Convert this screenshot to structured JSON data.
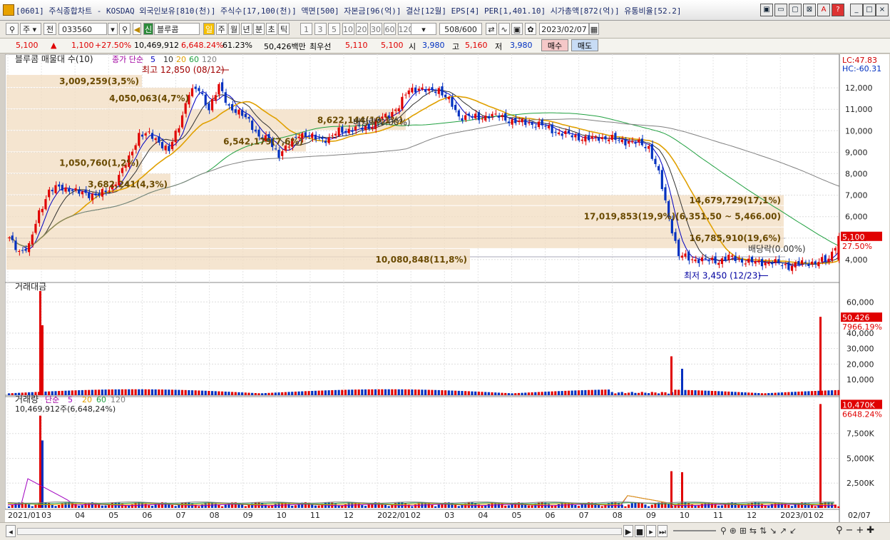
{
  "window": {
    "title": "[0601] 주식종합차트 - KOSDAQ 외국인보유[810(천)] 주식수[17,100(천)] 액면[500] 자본금[96(억)] 결산[12월] EPS[4] PER[1,401.10] 시가총액[872(억)] 유통비율[52.2]",
    "buttons": [
      "▣",
      "▭",
      "▢",
      "⊠",
      "A",
      "?",
      "_",
      "□",
      "×"
    ]
  },
  "toolbar": {
    "period_select": "주",
    "jeon_label": "전",
    "code_value": "033560",
    "stock_name": "블루콤",
    "period_tabs": [
      "일",
      "주",
      "월",
      "년",
      "분",
      "초",
      "틱"
    ],
    "minute_tabs": [
      "1",
      "3",
      "5",
      "10",
      "20",
      "30",
      "60",
      "120"
    ],
    "count_value": "508",
    "count_total": "/600",
    "date_value": "2023/02/07"
  },
  "quote": {
    "price": "5,100",
    "change": "1,100",
    "change_pct": "+27.50%",
    "volume": "10,469,912",
    "volume_ratio": "6,648.24%",
    "turnover": "61.23%",
    "amount": "50,426백만",
    "bid_label": "최우선",
    "ask": "5,110",
    "bid": "5,100",
    "open_label": "시",
    "open": "3,980",
    "high_label": "고",
    "high": "5,160",
    "low_label": "저",
    "low": "3,980",
    "buy_label": "매수",
    "sell_label": "매도"
  },
  "chart_data": [
    {
      "type": "candlestick",
      "title": "블루콤 매물대 수(10)",
      "ma_label": "종가 단순",
      "ma_periods": [
        "5",
        "10",
        "20",
        "60",
        "120"
      ],
      "ma_colors": [
        "#0000c0",
        "#303030",
        "#e0a000",
        "#20a040",
        "#808080"
      ],
      "yticks": [
        "12,000",
        "11,000",
        "10,000",
        "9,000",
        "8,000",
        "7,000",
        "6,000",
        "5,000",
        "4,000"
      ],
      "ylim": [
        3000,
        13100
      ],
      "x_labels": [
        "2021/01",
        "03",
        "04",
        "05",
        "06",
        "07",
        "08",
        "09",
        "10",
        "11",
        "12",
        "2022/01",
        "02",
        "03",
        "04",
        "05",
        "06",
        "07",
        "08",
        "09",
        "10",
        "11",
        "12",
        "2023/01",
        "02"
      ],
      "x_end_label": "02/07",
      "indicators": {
        "lc": "LC:47.83",
        "hc": "HC:-60.31"
      },
      "last_price": "5,100",
      "last_pct": "27.50%",
      "close_series": [
        4950,
        4400,
        4600,
        6200,
        7200,
        7350,
        7300,
        7100,
        7050,
        7000,
        7250,
        7900,
        8700,
        9850,
        9800,
        9500,
        9050,
        10250,
        11800,
        11900,
        11050,
        12050,
        11150,
        10800,
        10500,
        9700,
        9550,
        8900,
        9300,
        9900,
        9700,
        9650,
        9600,
        10000,
        10050,
        10100,
        10200,
        10500,
        10750,
        11150,
        11900,
        12000,
        11800,
        11950,
        11400,
        10650,
        10700,
        10550,
        10750,
        10650,
        10500,
        10400,
        10350,
        10300,
        10100,
        9900,
        9800,
        9700,
        9600,
        9700,
        9650,
        9550,
        9500,
        9400,
        9250,
        8000,
        6000,
        4200,
        4050,
        4000,
        3950,
        3950,
        4100,
        4000,
        3900,
        3850,
        3900,
        3800,
        3700,
        3800,
        3850,
        3900,
        4000,
        5100
      ],
      "volume_profile": [
        {
          "label": "1,050,760(1,2%)",
          "price_low": 8000,
          "price_high": 9000
        },
        {
          "label": "3,682,241(4,3%)",
          "price_low": 7000,
          "price_high": 8000
        },
        {
          "label": "10,080,848(11,8%)",
          "price_low": 3500,
          "price_high": 4500
        },
        {
          "label": "16,785,910(19,6%)",
          "price_low": 4500,
          "price_high": 5500
        },
        {
          "label": "17,019,853(19,9%)(6,351.50 ~ 5,466.00)",
          "price_low": 5500,
          "price_high": 6500
        },
        {
          "label": "14,679,729(17,1%)",
          "price_low": 6500,
          "price_high": 7000
        },
        {
          "label": "6,542,179(7,6%)",
          "price_low": 9000,
          "price_high": 10000
        },
        {
          "label": "8,622,144(10,1%)",
          "price_low": 10000,
          "price_high": 11000
        },
        {
          "label": "4,050,063(4,7%)",
          "price_low": 11000,
          "price_high": 12000
        },
        {
          "label": "3,009,259(3,5%)",
          "price_low": 12000,
          "price_high": 12600
        }
      ],
      "annotations": [
        {
          "text": "최고 12,850 (08/12)",
          "price": 12850
        },
        {
          "text": "최저 3,450 (12/23)",
          "price": 3450
        },
        {
          "text": "배당락(0.00%)",
          "price": 10400
        },
        {
          "text": "배당락(0.00%)",
          "price": 4500
        }
      ]
    },
    {
      "type": "bar",
      "title": "거래대금",
      "yticks": [
        "60,000",
        "40,000",
        "30,000",
        "20,000",
        "10,000"
      ],
      "ylim": [
        0,
        67000
      ],
      "last_value": "50,426",
      "last_pct": "7966.19%",
      "spikes": [
        {
          "month": "2021/01",
          "value": 67000
        },
        {
          "month": "2021/01",
          "value": 45000
        },
        {
          "month": "2022/09",
          "value": 25000
        },
        {
          "month": "2022/09",
          "value": 17000
        },
        {
          "month": "2023/02",
          "value": 50426
        }
      ]
    },
    {
      "type": "bar",
      "title": "거래량",
      "ma_label": "단순",
      "ma_periods": [
        "5",
        "20",
        "60",
        "120"
      ],
      "ma_colors": [
        "#a000c0",
        "#e0a000",
        "#20a040",
        "#808080"
      ],
      "subtitle": "10,469,912주(6,648,24%)",
      "yticks": [
        "7,500K",
        "5,000K",
        "2,500K"
      ],
      "ylim": [
        0,
        10500000
      ],
      "last_value": "10,470K",
      "last_pct": "6648.24%",
      "spikes": [
        {
          "month": "2021/01",
          "value": 9300000
        },
        {
          "month": "2021/01",
          "value": 6800000
        },
        {
          "month": "2022/09",
          "value": 3700000
        },
        {
          "month": "2022/09",
          "value": 3600000
        },
        {
          "month": "2023/02",
          "value": 10469912
        }
      ]
    }
  ],
  "colors": {
    "up": "#e00000",
    "down": "#0030c0",
    "profile": "#f2dcc0",
    "profile_text": "#6a4a00"
  }
}
